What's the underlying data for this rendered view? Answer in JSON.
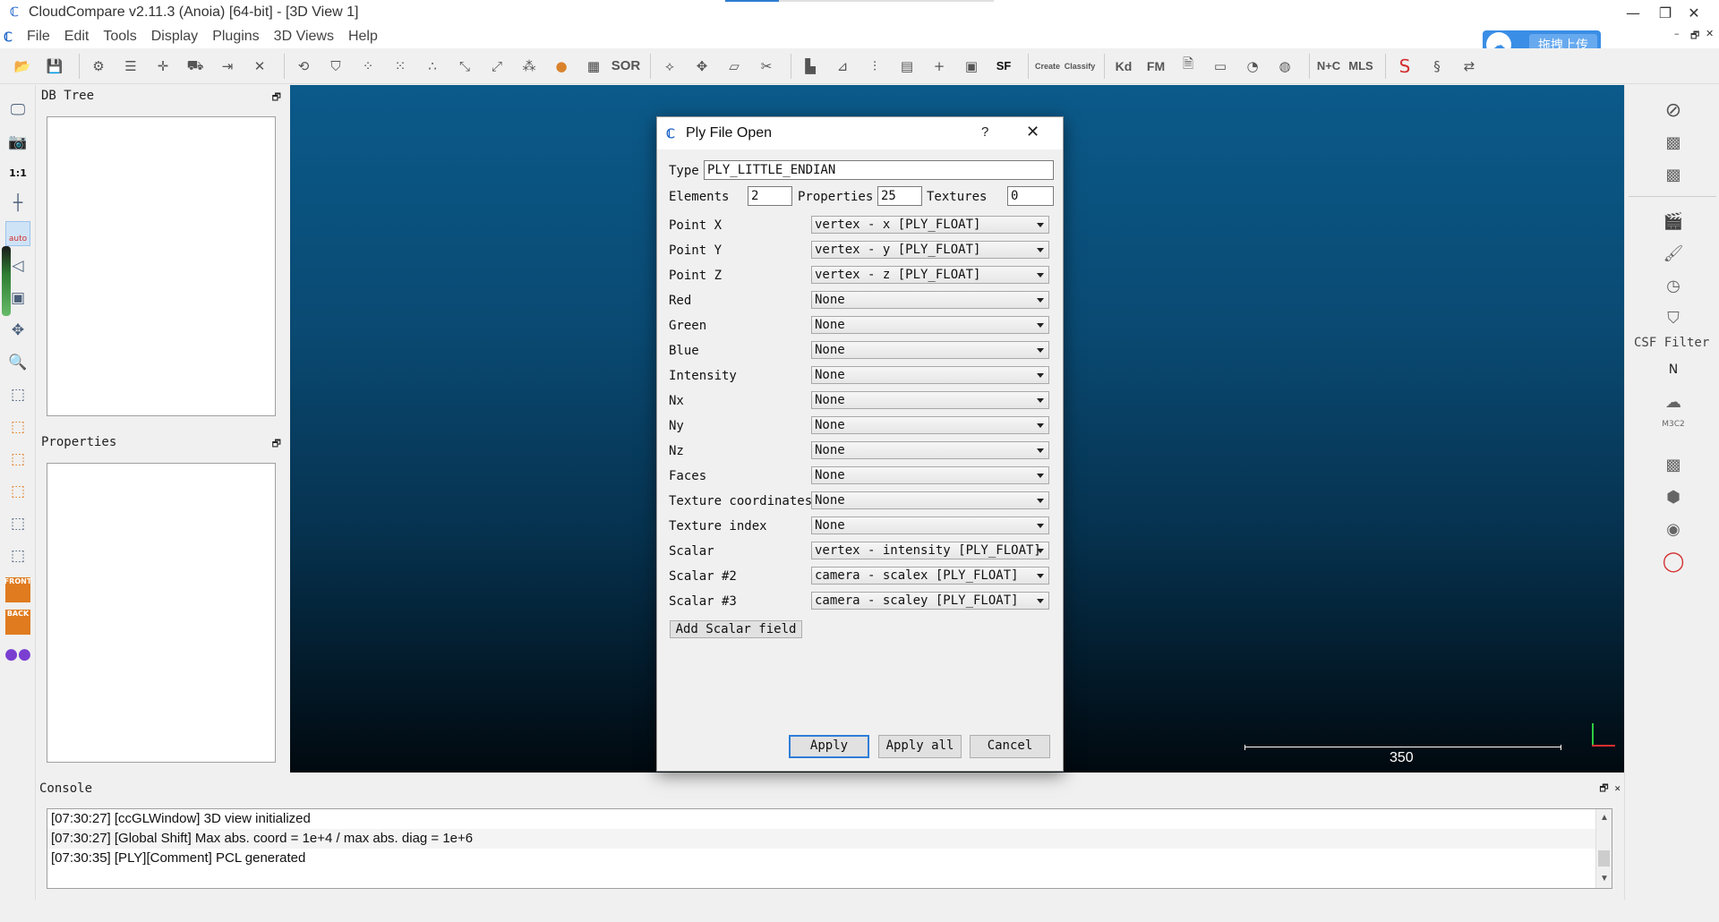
{
  "window": {
    "title": "CloudCompare v2.11.3 (Anoia) [64-bit] - [3D View 1]",
    "logo": "cc-logo",
    "controls": {
      "minimize": "—",
      "restore": "❐",
      "close": "✕"
    }
  },
  "menu": {
    "items": [
      "File",
      "Edit",
      "Tools",
      "Display",
      "Plugins",
      "3D Views",
      "Help"
    ],
    "mdi_controls": {
      "minimize": "–",
      "restore": "🗗",
      "close": "✕"
    }
  },
  "upload_button": {
    "label": "拖拽上传"
  },
  "toolbar": {
    "sor_label": "SOR",
    "sf_label": "SF",
    "canupo_create": "Create",
    "canupo_classify": "Classify",
    "kd_label": "Kd",
    "fm_label": "FM",
    "nc_label": "N+C",
    "mls_label": "MLS"
  },
  "left_toolbar": {
    "ratio_label": "1:1",
    "auto_label": "auto",
    "front_label": "FRONT",
    "back_label": "BACK"
  },
  "right_toolbar": {
    "csf_label": "CSF Filter",
    "north_label": "N",
    "m3c2_label": "M3C2"
  },
  "panels": {
    "db_tree": {
      "title": "DB Tree"
    },
    "properties": {
      "title": "Properties"
    },
    "console": {
      "title": "Console"
    }
  },
  "view3d": {
    "scale_label": "350"
  },
  "console": {
    "lines": [
      "[07:30:27] [ccGLWindow] 3D view initialized",
      "[07:30:27] [Global Shift] Max abs. coord = 1e+4 / max abs. diag = 1e+6",
      "[07:30:35] [PLY][Comment] PCL generated"
    ]
  },
  "dialog": {
    "title": "Ply File Open",
    "help": "?",
    "close": "✕",
    "type_label": "Type",
    "type_value": "PLY_LITTLE_ENDIAN",
    "elements_label": "Elements",
    "elements_value": "2",
    "properties_label": "Properties",
    "properties_value": "25",
    "textures_label": "Textures",
    "textures_value": "0",
    "rows": [
      {
        "label": "Point X",
        "value": "vertex - x [PLY_FLOAT]"
      },
      {
        "label": "Point Y",
        "value": "vertex - y [PLY_FLOAT]"
      },
      {
        "label": "Point Z",
        "value": "vertex - z [PLY_FLOAT]"
      },
      {
        "label": "Red",
        "value": "None"
      },
      {
        "label": "Green",
        "value": "None"
      },
      {
        "label": "Blue",
        "value": "None"
      },
      {
        "label": "Intensity",
        "value": "None"
      },
      {
        "label": "Nx",
        "value": "None"
      },
      {
        "label": "Ny",
        "value": "None"
      },
      {
        "label": "Nz",
        "value": "None"
      },
      {
        "label": "Faces",
        "value": "None"
      },
      {
        "label": "Texture coordinates",
        "value": "None"
      },
      {
        "label": "Texture index",
        "value": "None"
      },
      {
        "label": "Scalar",
        "value": "vertex - intensity [PLY_FLOAT]"
      },
      {
        "label": "Scalar #2",
        "value": "camera - scalex [PLY_FLOAT]"
      },
      {
        "label": "Scalar #3",
        "value": "camera - scaley [PLY_FLOAT]"
      }
    ],
    "add_scalar_label": "Add Scalar field",
    "apply_label": "Apply",
    "apply_all_label": "Apply all",
    "cancel_label": "Cancel"
  },
  "colors": {
    "view_top": "#0b5a8a",
    "view_bottom": "#01090f",
    "accent": "#2f7ed8",
    "upload": "#3a8ee6"
  }
}
